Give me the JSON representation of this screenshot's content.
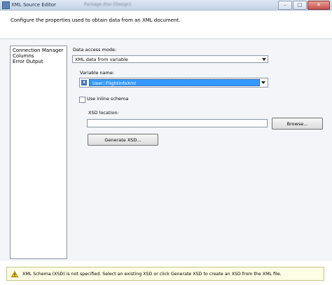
{
  "window": {
    "title": "XML Source Editor",
    "blurred_subtitle": "Package.dtsx [Design]",
    "controls": {
      "minimize": "–",
      "maximize": "□",
      "close": "✕"
    }
  },
  "header": {
    "description": "Configure the properties used to obtain data from an XML document."
  },
  "nav": {
    "items": [
      {
        "label": "Connection Manager"
      },
      {
        "label": "Columns"
      },
      {
        "label": "Error Output"
      }
    ]
  },
  "form": {
    "data_access_mode_label": "Data access mode:",
    "data_access_mode_value": "XML data from variable",
    "variable_name_label": "Variable name:",
    "variable_name_value": "User::FlightInfoXml",
    "variable_icon": "x",
    "inline_schema_label": "Use inline schema",
    "inline_schema_checked": false,
    "xsd_location_label": "XSD location:",
    "xsd_location_value": "",
    "browse_button": "Browse...",
    "generate_xsd_button": "Generate XSD..."
  },
  "status": {
    "icon": "warning-icon",
    "message": "XML Schema (XSD) is not specified. Select an existing XSD or click Generate XSD to create an XSD from the XML file."
  },
  "colors": {
    "selection": "#3399ff",
    "warning_bg": "#fdfce4",
    "warning_icon": "#f2c400"
  }
}
